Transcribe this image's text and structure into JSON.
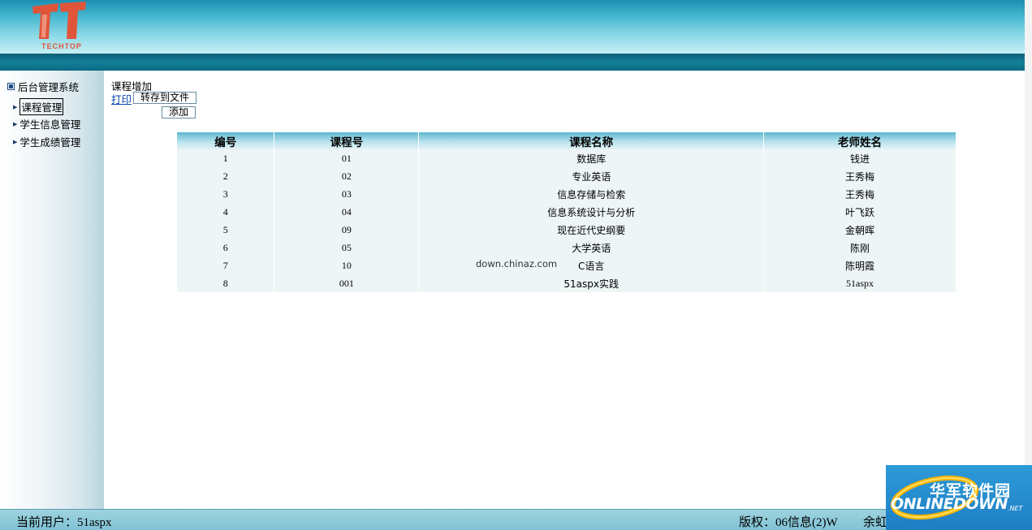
{
  "header": {
    "logo_text": "TECHTOP"
  },
  "sidebar": {
    "title": "后台管理系统",
    "items": [
      {
        "label": "课程管理",
        "active": true
      },
      {
        "label": "学生信息管理",
        "active": false
      },
      {
        "label": "学生成绩管理",
        "active": false
      }
    ]
  },
  "main": {
    "title": "课程增加",
    "print_link": "打印",
    "save_button": "转存到文件",
    "add_button": "添加"
  },
  "table": {
    "headers": [
      "编号",
      "课程号",
      "课程名称",
      "老师姓名"
    ],
    "rows": [
      [
        "1",
        "01",
        "数据库",
        "钱进"
      ],
      [
        "2",
        "02",
        "专业英语",
        "王秀梅"
      ],
      [
        "3",
        "03",
        "信息存储与检索",
        "王秀梅"
      ],
      [
        "4",
        "04",
        "信息系统设计与分析",
        "叶飞跃"
      ],
      [
        "5",
        "09",
        "现在近代史纲要",
        "金朝晖"
      ],
      [
        "6",
        "05",
        "大学英语",
        "陈刚"
      ],
      [
        "7",
        "10",
        "C语言",
        "陈明霞"
      ],
      [
        "8",
        "001",
        "51aspx实践",
        "51aspx"
      ]
    ]
  },
  "watermark": "down.chinaz.com",
  "footer": {
    "user": "当前用户：51aspx",
    "copyright": "版权：06信息(2)W",
    "extra": "余虹"
  },
  "badge": {
    "cn": "华军软件园",
    "en": "ONLINEDOWN",
    "net": ".NET"
  },
  "colors": {
    "header_top": "#1b8fb1",
    "header_bar": "#0f5f78",
    "table_header": "#5fb7d1",
    "table_row": "#eef5f6",
    "logo_red": "#e0553a"
  }
}
